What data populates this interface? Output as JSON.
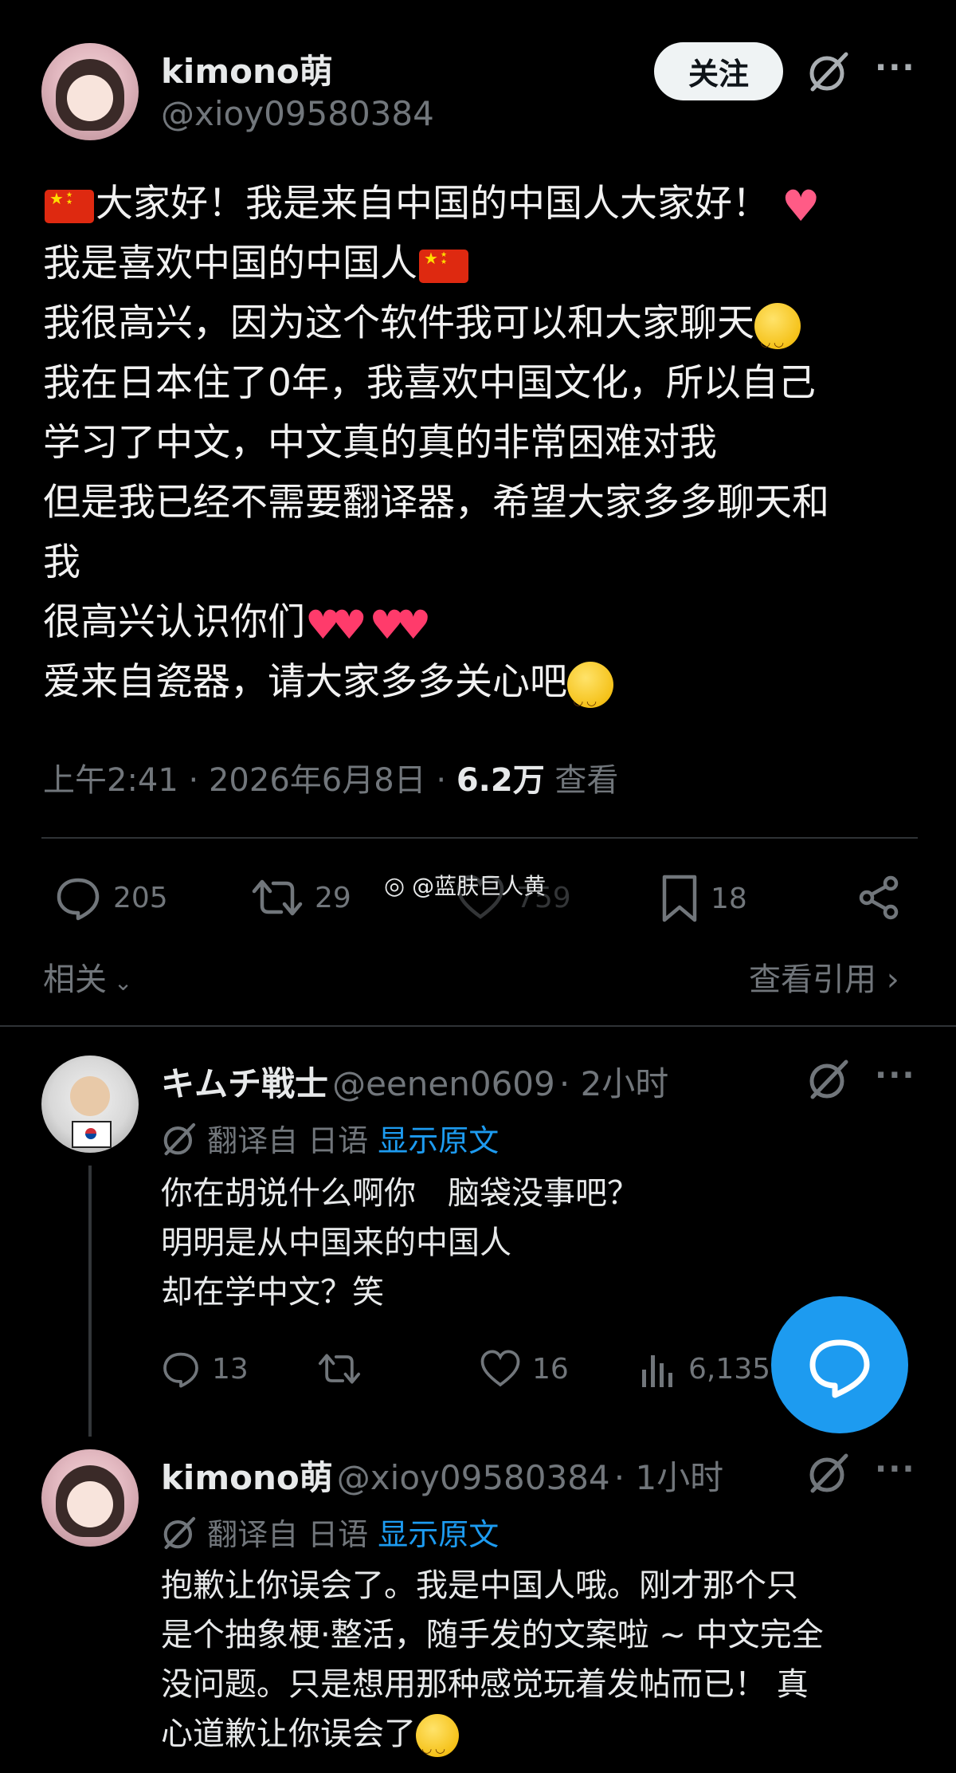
{
  "tweet": {
    "author_name": "kimono萌",
    "author_handle": "@xioy09580384",
    "follow_label": "关注",
    "lines": [
      "大家好！我是来自中国的中国人大家好！",
      "我是喜欢中国的中国人",
      "我很高兴，因为这个软件我可以和大家聊天",
      "我在日本住了0年，我喜欢中国文化，所以自己",
      "学习了中文，中文真的真的非常困难对我",
      "但是我已经不需要翻译器，希望大家多多聊天和",
      "我",
      "很高兴认识你们",
      "爱来自瓷器，请大家多多关心吧"
    ],
    "meta": {
      "time": "上午2:41",
      "date": "2026年6月8日",
      "views": "6.2万",
      "views_label": "查看"
    },
    "actions": {
      "replies": "205",
      "retweets": "29",
      "likes": "759",
      "bookmarks": "18"
    },
    "related_label": "相关",
    "quotes_label": "查看引用"
  },
  "watermark": "@蓝肤巨人黄",
  "replies": [
    {
      "author_name": "キムチ戦士",
      "author_handle": "@eenen0609",
      "time": "2小时",
      "translated_from": "翻译自 日语",
      "show_original": "显示原文",
      "lines": [
        "你在胡说什么啊你　脑袋没事吧？",
        "明明是从中国来的中国人",
        "却在学中文？笑"
      ],
      "actions": {
        "replies": "13",
        "likes": "16",
        "views": "6,135"
      }
    },
    {
      "author_name": "kimono萌",
      "author_handle": "@xioy09580384",
      "time": "1小时",
      "translated_from": "翻译自 日语",
      "show_original": "显示原文",
      "lines": [
        "抱歉让你误会了。我是中国人哦。刚才那个只",
        "是个抽象梗·整活，随手发的文案啦 ~ 中文完全",
        "没问题。只是想用那种感觉玩着发帖而已！ 真",
        "心道歉让你误会了"
      ]
    }
  ],
  "icons": {
    "reply": "reply-icon",
    "retweet": "retweet-icon",
    "like": "heart-icon",
    "bookmark": "bookmark-icon",
    "share": "share-icon",
    "analytics": "analytics-icon",
    "grok": "grok-icon",
    "more": "more-icon",
    "weibo": "weibo-icon"
  },
  "colors": {
    "background": "#000000",
    "accent": "#1d9bf0",
    "muted": "#71767b",
    "text": "#e7e9ea"
  }
}
